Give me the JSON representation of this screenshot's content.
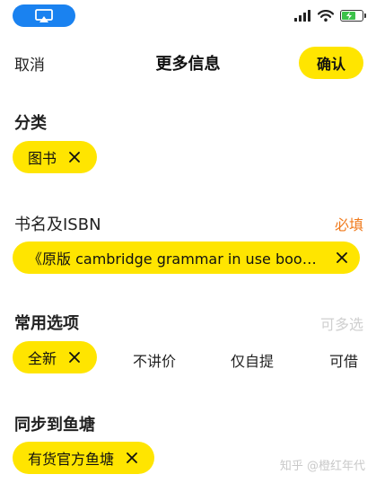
{
  "status_bar": {
    "airplay_icon": "airplay-icon",
    "signal_icon": "cellular-signal-icon",
    "wifi_icon": "wifi-icon",
    "battery_icon": "battery-charging-icon",
    "battery_color": "#3cc24a"
  },
  "nav": {
    "cancel_label": "取消",
    "title": "更多信息",
    "confirm_label": "确认"
  },
  "category": {
    "title": "分类",
    "chip_label": "图书"
  },
  "book": {
    "title": "书名及ISBN",
    "required_label": "必填",
    "required_color": "#f07a1c",
    "value": "《原版 cambridge grammar in use book ..."
  },
  "options": {
    "title": "常用选项",
    "hint": "可多选",
    "items": [
      {
        "label": "全新",
        "selected": true
      },
      {
        "label": "不讲价",
        "selected": false
      },
      {
        "label": "仅自提",
        "selected": false
      },
      {
        "label": "可借",
        "selected": false
      }
    ]
  },
  "fishpond": {
    "title": "同步到鱼塘",
    "chip_label": "有货官方鱼塘"
  },
  "watermark": "知乎 @橙红年代",
  "colors": {
    "accent_yellow": "#ffe500",
    "airplay_blue": "#1a82f0"
  }
}
